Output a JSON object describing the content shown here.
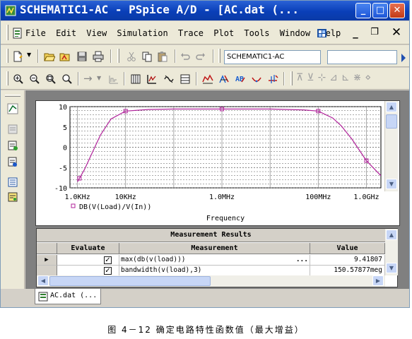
{
  "window": {
    "title": "SCHEMATIC1-AC - PSpice A/D - [AC.dat (...",
    "icon": "pspice-app-icon",
    "controls": [
      "minimize",
      "maximize",
      "close"
    ]
  },
  "menubar": {
    "items": [
      "File",
      "Edit",
      "View",
      "Simulation",
      "Trace",
      "Plot",
      "Tools",
      "Window",
      "Help"
    ],
    "mdi_controls": [
      "minimize",
      "restore",
      "close"
    ]
  },
  "toolbar": {
    "profile": "SCHEMATIC1-AC",
    "search_value": ""
  },
  "plot": {
    "chart_data": {
      "type": "line",
      "x": [
        1000,
        1400,
        2000,
        3000,
        5000,
        10000,
        30000,
        100000,
        1000000,
        10000000,
        50000000,
        100000000,
        200000000,
        300000000,
        500000000,
        1000000000,
        2000000000
      ],
      "series": [
        {
          "name": "DB(V(Load)/V(In))",
          "values": [
            -8.5,
            -5.5,
            -1.5,
            3.0,
            7.0,
            8.9,
            9.3,
            9.4,
            9.41,
            9.4,
            9.2,
            8.9,
            7.2,
            5.3,
            2.0,
            -3.3,
            -7.0
          ]
        }
      ],
      "xscale": "log",
      "xlim": [
        700,
        2000000000
      ],
      "ylim": [
        -10,
        10
      ],
      "yticks": [
        "10",
        "5",
        "0",
        "-5",
        "-10"
      ],
      "xticks": [
        "1.0KHz",
        "10KHz",
        "1.0MHz",
        "100MHz",
        "1.0GHz"
      ],
      "xlabel": "Frequency",
      "ylabel": "",
      "grid": true,
      "legend_position": "bottom-left",
      "series_color": "#b0229a"
    }
  },
  "measurement": {
    "title": "Measurement Results",
    "columns": [
      "Evaluate",
      "Measurement",
      "Value"
    ],
    "rows": [
      {
        "selected": true,
        "evaluate": true,
        "measurement": "max(db(v(load)))",
        "value": "9.41807"
      },
      {
        "selected": false,
        "evaluate": true,
        "measurement": "bandwidth(v(load),3)",
        "value": "150.57877meg"
      }
    ]
  },
  "tabs": [
    {
      "label": "AC.dat (..."
    }
  ],
  "caption": "图 4－12 确定电路特性函数值（最大增益）"
}
